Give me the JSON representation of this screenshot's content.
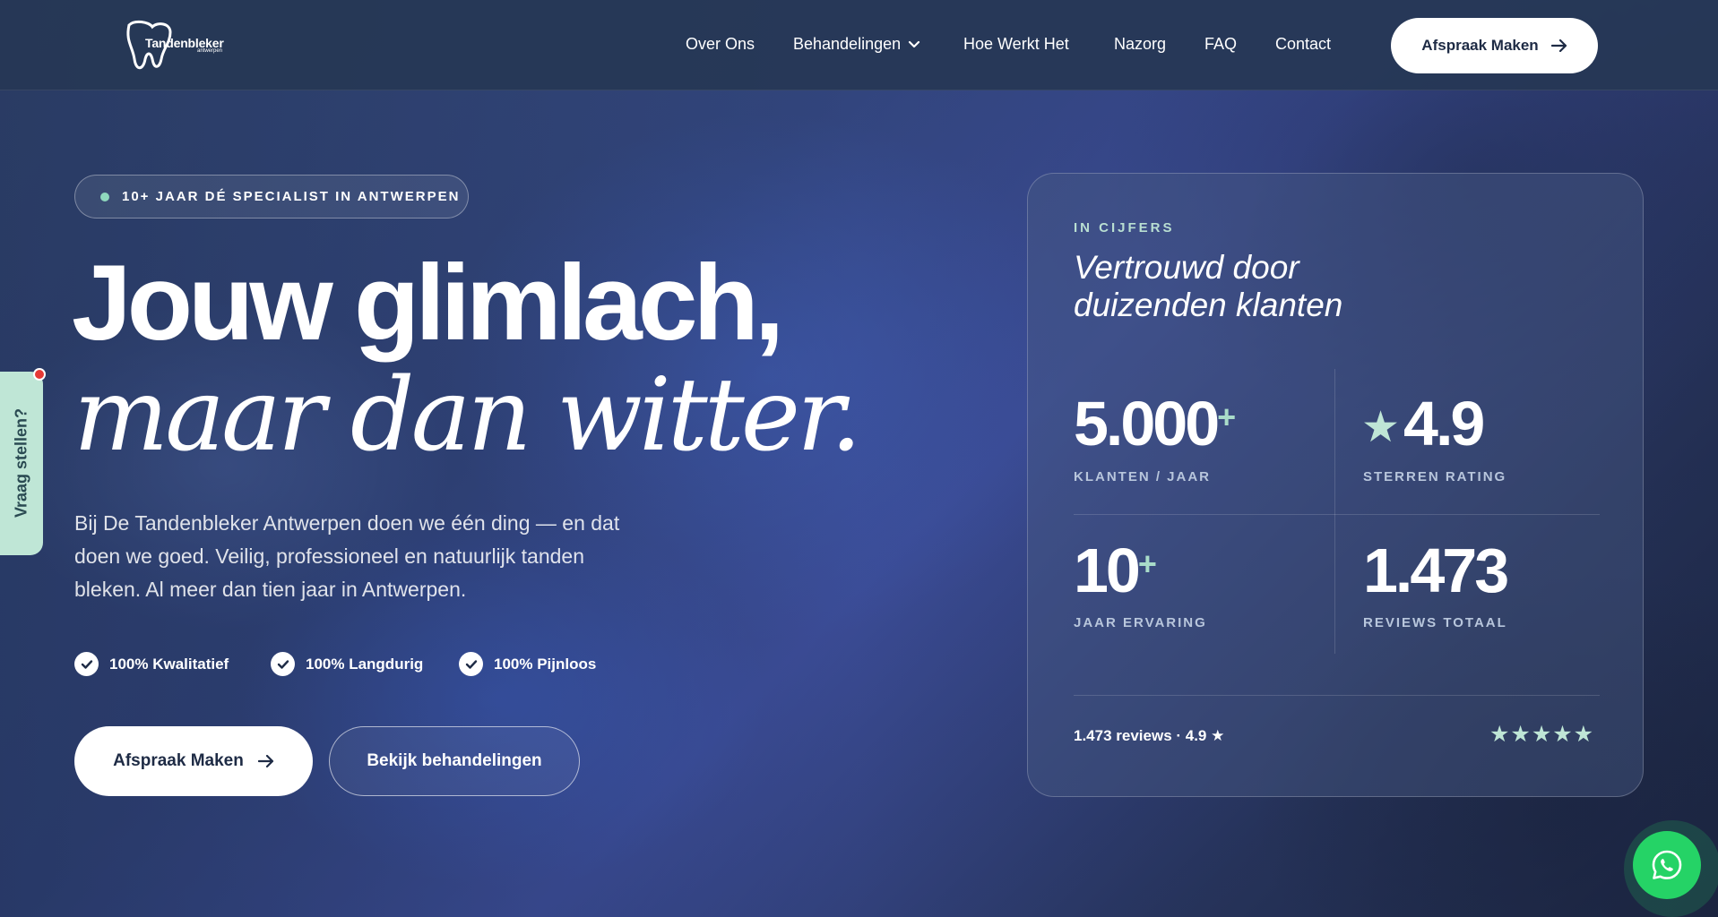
{
  "brand": {
    "logo_text": "Tandenbleker",
    "logo_sub": "antwerpen"
  },
  "nav": {
    "items": [
      "Over Ons",
      "Behandelingen",
      "Hoe Werkt Het",
      "Nazorg",
      "FAQ",
      "Contact"
    ],
    "cta": "Afspraak Maken"
  },
  "hero": {
    "badge": "10+ JAAR DÉ SPECIALIST IN ANTWERPEN",
    "title_line1": "Jouw glimlach,",
    "title_line2": "maar dan witter.",
    "lead": "Bij De Tandenbleker Antwerpen doen we één ding — en dat doen we goed. Veilig, professioneel en natuurlijk tanden bleken. Al meer dan tien jaar in Antwerpen.",
    "checks": [
      "100% Kwalitatief",
      "100% Langdurig",
      "100% Pijnloos"
    ],
    "primary_button": "Afspraak Maken",
    "secondary_button": "Bekijk behandelingen"
  },
  "side_tab": {
    "label": "Vraag stellen?"
  },
  "stats_card": {
    "eyebrow": "IN CIJFERS",
    "title": "Vertrouwd door duizenden klanten",
    "stats": [
      {
        "value": "5.000",
        "suffix": "+",
        "label": "KLANTEN / JAAR"
      },
      {
        "value": "4.9",
        "prefix_icon": "star-icon",
        "label": "STERREN RATING"
      },
      {
        "value": "10",
        "suffix": "+",
        "label": "JAAR ERVARING"
      },
      {
        "value": "1.473",
        "label": "REVIEWS TOTAAL"
      }
    ],
    "footer": "1.473 reviews · 4.9 ★",
    "stars": "★★★★★"
  },
  "colors": {
    "accent_mint": "#bfe6d6",
    "whatsapp": "#25d366",
    "header_bg": "#263755"
  }
}
